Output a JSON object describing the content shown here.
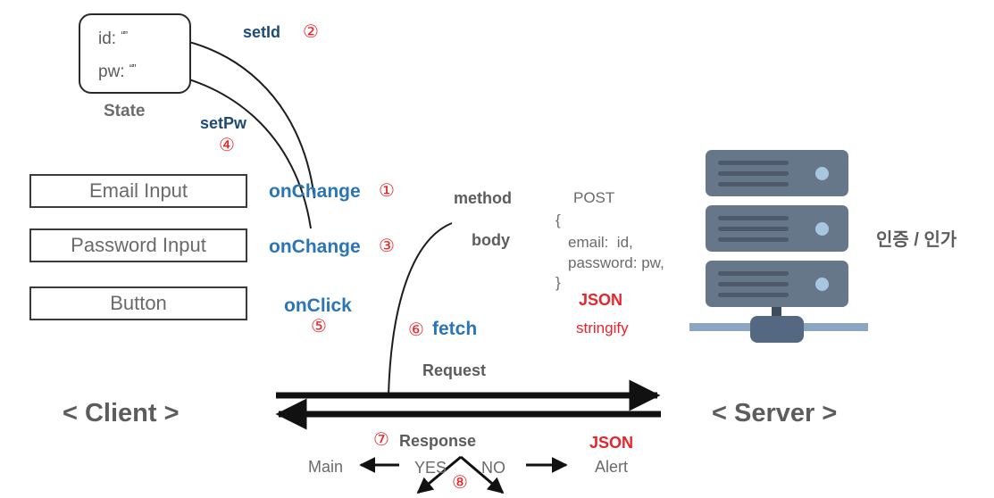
{
  "diagram": {
    "title": "Client-Server login request flow",
    "colors": {
      "blue_bright": "#2a75b8",
      "blue_dark": "#1f4a73",
      "red": "#e8242a",
      "gray_text": "#5c5c5c",
      "server_body": "#67778a",
      "server_dot": "#a9c6e0",
      "server_floor": "#8ba5c2"
    }
  },
  "state": {
    "label": "State",
    "fields": [
      {
        "key": "id:",
        "value": "“”"
      },
      {
        "key": "pw:",
        "value": "“”"
      }
    ],
    "id_key": "id:",
    "id_value": "“”",
    "pw_key": "pw:",
    "pw_value": "“”"
  },
  "client": {
    "caption": "< Client >",
    "boxes": [
      {
        "label": "Email Input"
      },
      {
        "label": "Password Input"
      },
      {
        "label": "Button"
      }
    ],
    "email_label": "Email Input",
    "password_label": "Password Input",
    "button_label": "Button"
  },
  "handlers": {
    "onchange_email": "onChange",
    "onchange_password": "onChange",
    "onclick_button": "onClick",
    "set_id": "setId",
    "set_pw": "setPw",
    "fetch": "fetch"
  },
  "steps": {
    "s1": "①",
    "s2": "②",
    "s3": "③",
    "s4": "④",
    "s5": "⑤",
    "s6": "⑥",
    "s7": "⑦",
    "s8": "⑧"
  },
  "fetch_options": {
    "method_key": "method",
    "method_value": "POST",
    "body_key": "body",
    "body_brace_open": "{",
    "body_email": "email:  id,",
    "body_password": "password: pw,",
    "body_brace_close": "}",
    "json_word": "JSON",
    "stringify": "stringify"
  },
  "flow": {
    "request_label": "Request",
    "response_label": "Response",
    "response_json": "JSON"
  },
  "decision": {
    "yes": "YES",
    "no": "NO",
    "on_yes": "Main",
    "on_no": "Alert"
  },
  "server": {
    "caption": "< Server >",
    "label": "인증 / 인가"
  }
}
